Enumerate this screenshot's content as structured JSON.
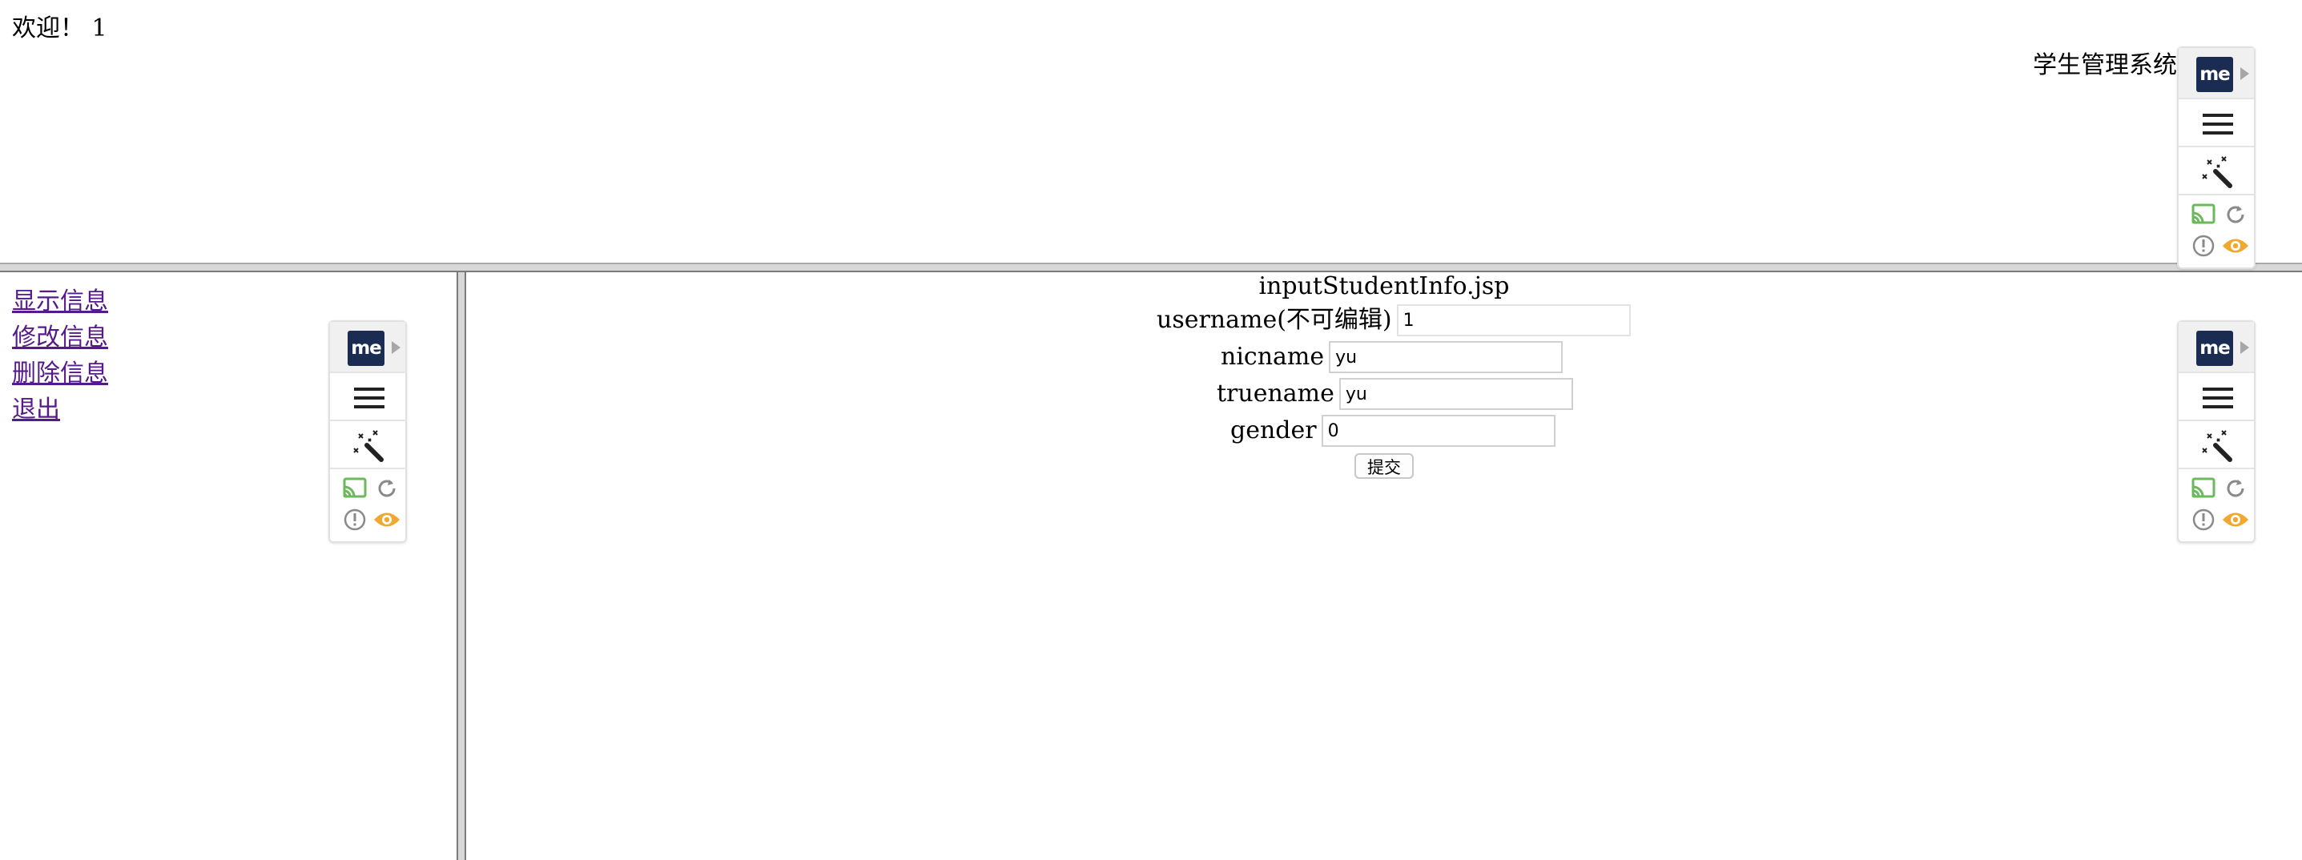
{
  "top": {
    "welcome_text": "欢迎！ 1",
    "system_title": "学生管理系统"
  },
  "sidebar": {
    "links": [
      {
        "label": "显示信息"
      },
      {
        "label": "修改信息"
      },
      {
        "label": "删除信息"
      },
      {
        "label": "退出"
      }
    ]
  },
  "main": {
    "heading": "inputStudentInfo.jsp",
    "form": {
      "username": {
        "label": "username(不可编辑)",
        "value": "1"
      },
      "nicname": {
        "label": "nicname",
        "value": "yu"
      },
      "truename": {
        "label": "truename",
        "value": "yu"
      },
      "gender": {
        "label": "gender",
        "value": "0"
      },
      "submit_label": "提交"
    }
  },
  "extension": {
    "logo_text": "me",
    "icons": [
      "menu-icon",
      "magic-wand-icon",
      "cast-icon",
      "refresh-icon",
      "alert-icon",
      "eye-icon"
    ],
    "colors": {
      "logo_bg": "#1b2c52",
      "cast": "#6cb85c",
      "eye": "#f0a830",
      "neutral": "#8a8a8a"
    }
  },
  "colors": {
    "visited_link": "#551a8b",
    "frame_border": "#d8d8d8"
  }
}
